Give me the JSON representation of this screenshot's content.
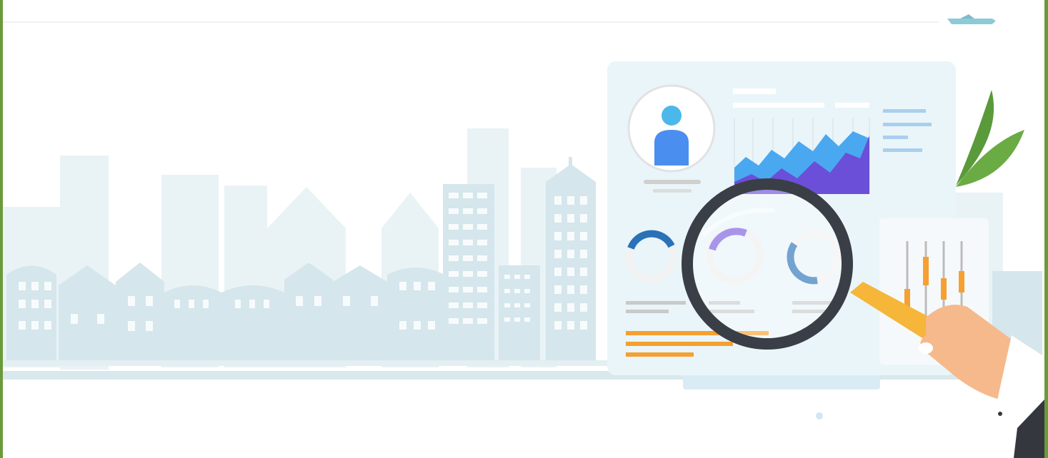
{
  "illustration": {
    "subject": "analytics-search-illustration",
    "icons": [
      "airplane-icon",
      "leaf-icon",
      "user-avatar-icon",
      "magnifying-glass-icon",
      "hand-icon"
    ],
    "colors": {
      "frame": "#6a9a3a",
      "city": "#d4e6ec",
      "city_light": "#e6f1f4",
      "panel": "#e8f4f8",
      "area_blue": "#4aa8f0",
      "area_purple": "#6b4fd8",
      "orange": "#f5a030",
      "glass_ring": "#3a3e46",
      "handle": "#f5b63a",
      "skin": "#f6b98c",
      "leaf": "#5a9a3a"
    }
  }
}
